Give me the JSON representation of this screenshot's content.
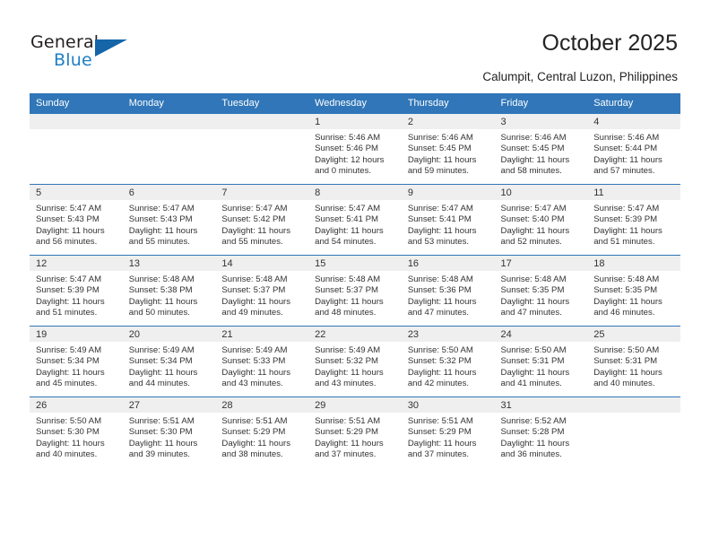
{
  "brand": {
    "name_top": "General",
    "name_bottom": "Blue",
    "triangle_icon": "triangle-icon",
    "accent_color": "#1f7ec4",
    "header_color": "#3076b8"
  },
  "header": {
    "title": "October 2025",
    "subtitle": "Calumpit, Central Luzon, Philippines"
  },
  "calendar": {
    "weekdays": [
      "Sunday",
      "Monday",
      "Tuesday",
      "Wednesday",
      "Thursday",
      "Friday",
      "Saturday"
    ],
    "weeks": [
      [
        {
          "day": ""
        },
        {
          "day": ""
        },
        {
          "day": ""
        },
        {
          "day": "1",
          "sunrise": "Sunrise: 5:46 AM",
          "sunset": "Sunset: 5:46 PM",
          "daylight_line1": "Daylight: 12 hours",
          "daylight_line2": "and 0 minutes."
        },
        {
          "day": "2",
          "sunrise": "Sunrise: 5:46 AM",
          "sunset": "Sunset: 5:45 PM",
          "daylight_line1": "Daylight: 11 hours",
          "daylight_line2": "and 59 minutes."
        },
        {
          "day": "3",
          "sunrise": "Sunrise: 5:46 AM",
          "sunset": "Sunset: 5:45 PM",
          "daylight_line1": "Daylight: 11 hours",
          "daylight_line2": "and 58 minutes."
        },
        {
          "day": "4",
          "sunrise": "Sunrise: 5:46 AM",
          "sunset": "Sunset: 5:44 PM",
          "daylight_line1": "Daylight: 11 hours",
          "daylight_line2": "and 57 minutes."
        }
      ],
      [
        {
          "day": "5",
          "sunrise": "Sunrise: 5:47 AM",
          "sunset": "Sunset: 5:43 PM",
          "daylight_line1": "Daylight: 11 hours",
          "daylight_line2": "and 56 minutes."
        },
        {
          "day": "6",
          "sunrise": "Sunrise: 5:47 AM",
          "sunset": "Sunset: 5:43 PM",
          "daylight_line1": "Daylight: 11 hours",
          "daylight_line2": "and 55 minutes."
        },
        {
          "day": "7",
          "sunrise": "Sunrise: 5:47 AM",
          "sunset": "Sunset: 5:42 PM",
          "daylight_line1": "Daylight: 11 hours",
          "daylight_line2": "and 55 minutes."
        },
        {
          "day": "8",
          "sunrise": "Sunrise: 5:47 AM",
          "sunset": "Sunset: 5:41 PM",
          "daylight_line1": "Daylight: 11 hours",
          "daylight_line2": "and 54 minutes."
        },
        {
          "day": "9",
          "sunrise": "Sunrise: 5:47 AM",
          "sunset": "Sunset: 5:41 PM",
          "daylight_line1": "Daylight: 11 hours",
          "daylight_line2": "and 53 minutes."
        },
        {
          "day": "10",
          "sunrise": "Sunrise: 5:47 AM",
          "sunset": "Sunset: 5:40 PM",
          "daylight_line1": "Daylight: 11 hours",
          "daylight_line2": "and 52 minutes."
        },
        {
          "day": "11",
          "sunrise": "Sunrise: 5:47 AM",
          "sunset": "Sunset: 5:39 PM",
          "daylight_line1": "Daylight: 11 hours",
          "daylight_line2": "and 51 minutes."
        }
      ],
      [
        {
          "day": "12",
          "sunrise": "Sunrise: 5:47 AM",
          "sunset": "Sunset: 5:39 PM",
          "daylight_line1": "Daylight: 11 hours",
          "daylight_line2": "and 51 minutes."
        },
        {
          "day": "13",
          "sunrise": "Sunrise: 5:48 AM",
          "sunset": "Sunset: 5:38 PM",
          "daylight_line1": "Daylight: 11 hours",
          "daylight_line2": "and 50 minutes."
        },
        {
          "day": "14",
          "sunrise": "Sunrise: 5:48 AM",
          "sunset": "Sunset: 5:37 PM",
          "daylight_line1": "Daylight: 11 hours",
          "daylight_line2": "and 49 minutes."
        },
        {
          "day": "15",
          "sunrise": "Sunrise: 5:48 AM",
          "sunset": "Sunset: 5:37 PM",
          "daylight_line1": "Daylight: 11 hours",
          "daylight_line2": "and 48 minutes."
        },
        {
          "day": "16",
          "sunrise": "Sunrise: 5:48 AM",
          "sunset": "Sunset: 5:36 PM",
          "daylight_line1": "Daylight: 11 hours",
          "daylight_line2": "and 47 minutes."
        },
        {
          "day": "17",
          "sunrise": "Sunrise: 5:48 AM",
          "sunset": "Sunset: 5:35 PM",
          "daylight_line1": "Daylight: 11 hours",
          "daylight_line2": "and 47 minutes."
        },
        {
          "day": "18",
          "sunrise": "Sunrise: 5:48 AM",
          "sunset": "Sunset: 5:35 PM",
          "daylight_line1": "Daylight: 11 hours",
          "daylight_line2": "and 46 minutes."
        }
      ],
      [
        {
          "day": "19",
          "sunrise": "Sunrise: 5:49 AM",
          "sunset": "Sunset: 5:34 PM",
          "daylight_line1": "Daylight: 11 hours",
          "daylight_line2": "and 45 minutes."
        },
        {
          "day": "20",
          "sunrise": "Sunrise: 5:49 AM",
          "sunset": "Sunset: 5:34 PM",
          "daylight_line1": "Daylight: 11 hours",
          "daylight_line2": "and 44 minutes."
        },
        {
          "day": "21",
          "sunrise": "Sunrise: 5:49 AM",
          "sunset": "Sunset: 5:33 PM",
          "daylight_line1": "Daylight: 11 hours",
          "daylight_line2": "and 43 minutes."
        },
        {
          "day": "22",
          "sunrise": "Sunrise: 5:49 AM",
          "sunset": "Sunset: 5:32 PM",
          "daylight_line1": "Daylight: 11 hours",
          "daylight_line2": "and 43 minutes."
        },
        {
          "day": "23",
          "sunrise": "Sunrise: 5:50 AM",
          "sunset": "Sunset: 5:32 PM",
          "daylight_line1": "Daylight: 11 hours",
          "daylight_line2": "and 42 minutes."
        },
        {
          "day": "24",
          "sunrise": "Sunrise: 5:50 AM",
          "sunset": "Sunset: 5:31 PM",
          "daylight_line1": "Daylight: 11 hours",
          "daylight_line2": "and 41 minutes."
        },
        {
          "day": "25",
          "sunrise": "Sunrise: 5:50 AM",
          "sunset": "Sunset: 5:31 PM",
          "daylight_line1": "Daylight: 11 hours",
          "daylight_line2": "and 40 minutes."
        }
      ],
      [
        {
          "day": "26",
          "sunrise": "Sunrise: 5:50 AM",
          "sunset": "Sunset: 5:30 PM",
          "daylight_line1": "Daylight: 11 hours",
          "daylight_line2": "and 40 minutes."
        },
        {
          "day": "27",
          "sunrise": "Sunrise: 5:51 AM",
          "sunset": "Sunset: 5:30 PM",
          "daylight_line1": "Daylight: 11 hours",
          "daylight_line2": "and 39 minutes."
        },
        {
          "day": "28",
          "sunrise": "Sunrise: 5:51 AM",
          "sunset": "Sunset: 5:29 PM",
          "daylight_line1": "Daylight: 11 hours",
          "daylight_line2": "and 38 minutes."
        },
        {
          "day": "29",
          "sunrise": "Sunrise: 5:51 AM",
          "sunset": "Sunset: 5:29 PM",
          "daylight_line1": "Daylight: 11 hours",
          "daylight_line2": "and 37 minutes."
        },
        {
          "day": "30",
          "sunrise": "Sunrise: 5:51 AM",
          "sunset": "Sunset: 5:29 PM",
          "daylight_line1": "Daylight: 11 hours",
          "daylight_line2": "and 37 minutes."
        },
        {
          "day": "31",
          "sunrise": "Sunrise: 5:52 AM",
          "sunset": "Sunset: 5:28 PM",
          "daylight_line1": "Daylight: 11 hours",
          "daylight_line2": "and 36 minutes."
        },
        {
          "day": ""
        }
      ]
    ]
  }
}
